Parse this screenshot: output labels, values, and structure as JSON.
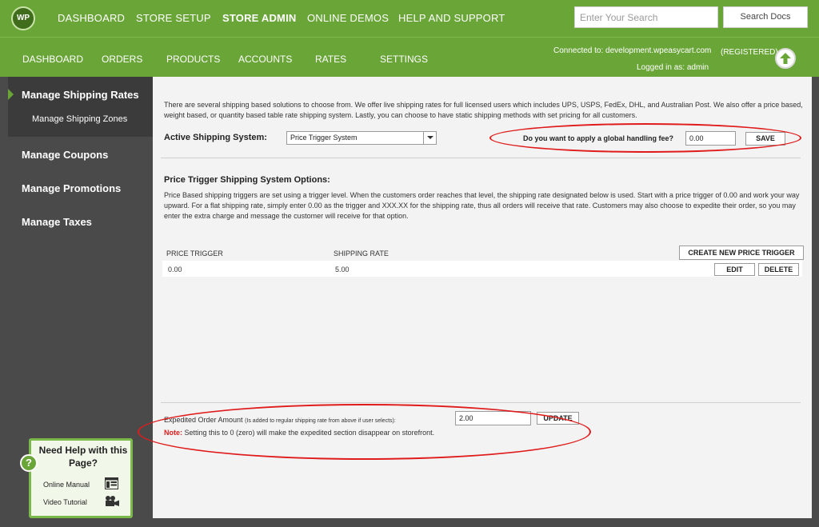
{
  "logo": "WP",
  "top_nav": [
    "DASHBOARD",
    "STORE SETUP",
    "STORE ADMIN",
    "ONLINE DEMOS",
    "HELP AND SUPPORT"
  ],
  "search": {
    "placeholder": "Enter Your Search",
    "button": "Search Docs"
  },
  "sub_nav": [
    "DASHBOARD",
    "ORDERS",
    "PRODUCTS",
    "ACCOUNTS",
    "RATES",
    "SETTINGS"
  ],
  "connection": {
    "connected": "Connected to: development.wpeasycart.com",
    "status": "(REGISTERED)",
    "logged_in": "Logged in as: admin"
  },
  "sidebar": {
    "items": [
      {
        "label": "Manage Shipping Rates",
        "sub": "Manage Shipping Zones"
      },
      {
        "label": "Manage Coupons"
      },
      {
        "label": "Manage Promotions"
      },
      {
        "label": "Manage Taxes"
      }
    ]
  },
  "help": {
    "title": "Need Help with this Page?",
    "manual": "Online Manual",
    "video": "Video Tutorial"
  },
  "intro": "There are several shipping based solutions to choose from.  We offer live shipping rates for full licensed users which includes UPS, USPS, FedEx, DHL, and Australian Post.  We also offer a price based, weight based, or quantity based table rate shipping system.  Lastly, you can choose to have static shipping methods with set pricing for all customers.",
  "active_system": {
    "label": "Active Shipping System:",
    "value": "Price Trigger System"
  },
  "handling": {
    "label": "Do you want to apply a global handling fee?",
    "value": "0.00",
    "button": "SAVE"
  },
  "options": {
    "title": "Price Trigger Shipping System Options:",
    "description": "Price Based shipping triggers are set using a trigger level.  When the customers order reaches that level, the shipping rate designated below is used.  Start with a price trigger of 0.00 and work your way upward.  For a flat shipping rate, simply enter 0.00 as the trigger and XXX.XX for the shipping rate, thus all orders will receive that rate.  Customers may also choose to expedite their order, so you may enter the extra charge and message the customer will receive for that option."
  },
  "table": {
    "headers": [
      "PRICE TRIGGER",
      "SHIPPING RATE"
    ],
    "create_button": "CREATE NEW PRICE TRIGGER",
    "rows": [
      {
        "trigger": "0.00",
        "rate": "5.00",
        "edit": "EDIT",
        "delete": "DELETE"
      }
    ]
  },
  "expedited": {
    "label": "Expedited Order Amount",
    "hint": "(Is added to regular shipping rate from above if user selects):",
    "value": "2.00",
    "button": "UPDATE",
    "note_label": "Note:",
    "note": "Setting this to 0 (zero) will make the expedited section disappear on storefront."
  },
  "colors": {
    "brand_green": "#6aa538",
    "sidebar": "#4a4a4a",
    "highlight": "#e01b1b"
  }
}
